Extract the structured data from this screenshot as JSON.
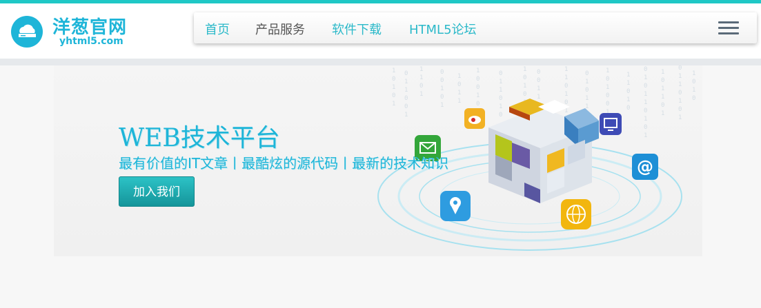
{
  "site": {
    "logo_text": "洋葱官网",
    "logo_domain": "yhtml5.com"
  },
  "nav": {
    "items": [
      {
        "label": "首页",
        "active": false
      },
      {
        "label": "产品服务",
        "active": true
      },
      {
        "label": "软件下载",
        "active": false
      },
      {
        "label": "HTML5论坛",
        "active": false
      }
    ],
    "menu_icon": "hamburger-menu-icon"
  },
  "banner": {
    "title": "WEB技术平台",
    "subtitle": "最有价值的IT文章丨最酷炫的源代码丨最新的技术知识",
    "button_label": "加入我们",
    "graphic": {
      "cube": "rubiks-cube-illustration",
      "icons": [
        "weibo-icon",
        "email-icon",
        "location-pin-icon",
        "globe-icon",
        "at-sign-icon",
        "tv-icon"
      ]
    }
  },
  "colors": {
    "accent": "#1eb5d8",
    "top_stripe": "#1fc8c6",
    "button": "#1aa8ad",
    "nav_active": "#555555"
  }
}
